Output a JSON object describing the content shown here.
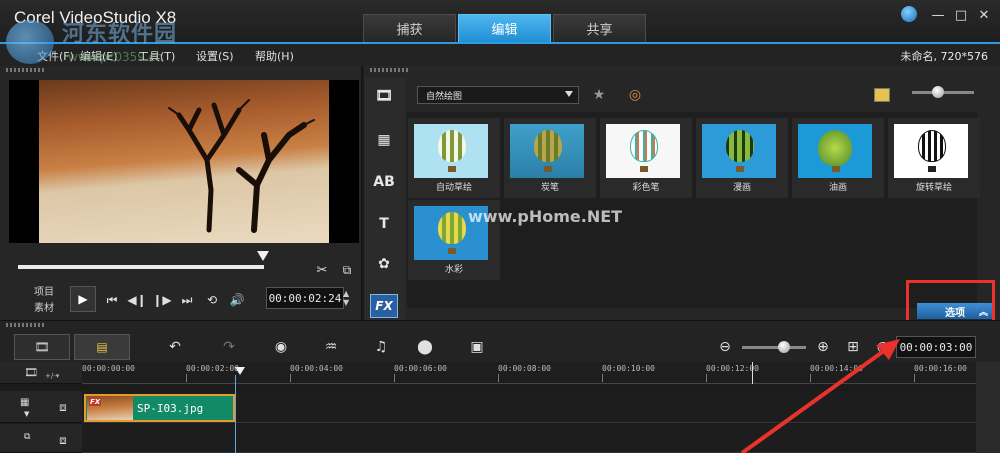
{
  "app": {
    "title": "Corel VideoStudio X8"
  },
  "tabs": [
    {
      "label": "捕获",
      "active": false
    },
    {
      "label": "编辑",
      "active": true
    },
    {
      "label": "共享",
      "active": false
    }
  ],
  "window_controls": {
    "minimize": "—",
    "maximize": "□",
    "close": "✕"
  },
  "menu": {
    "items": [
      "文件(F)",
      "编辑(E)",
      "工具(T)",
      "设置(S)",
      "帮助(H)"
    ],
    "project_info": "未命名, 720*576"
  },
  "watermark": {
    "text": "河东软件园",
    "url": "www.pc0359.cn",
    "center": "www.pHome.NET"
  },
  "player": {
    "mode_labels": [
      "项目",
      "素材"
    ],
    "timecode": "00:00:02:24",
    "controls": [
      "play-icon",
      "prev-icon",
      "back-icon",
      "forward-icon",
      "next-icon",
      "repeat-icon",
      "volume-icon"
    ],
    "scrub_progress": 1.0
  },
  "library": {
    "category": "自然绘图",
    "thumbnails": [
      {
        "label": "自动草绘",
        "style": "sketch-light"
      },
      {
        "label": "炭笔",
        "style": "charcoal"
      },
      {
        "label": "彩色笔",
        "style": "color-pen"
      },
      {
        "label": "漫画",
        "style": "comic"
      },
      {
        "label": "油画",
        "style": "oil"
      },
      {
        "label": "旋转草绘",
        "style": "bw-sketch"
      },
      {
        "label": "水彩",
        "style": "watercolor"
      }
    ],
    "options_label": "选项"
  },
  "timeline": {
    "time": "00:00:03:00",
    "ruler": [
      "00:00:00:00",
      "00:00:02:00",
      "00:00:04:00",
      "00:00:06:00",
      "00:00:08:00",
      "00:00:10:00",
      "00:00:12:00",
      "00:00:14:00",
      "00:00:16:00"
    ],
    "clip": {
      "name": "SP-I03.jpg",
      "badge": "FX"
    },
    "add_remove": "+/-▾"
  },
  "colors": {
    "accent": "#2d9be0",
    "clip": "#138a66",
    "clip_border": "#e39b2e",
    "highlight": "#e8322b"
  }
}
